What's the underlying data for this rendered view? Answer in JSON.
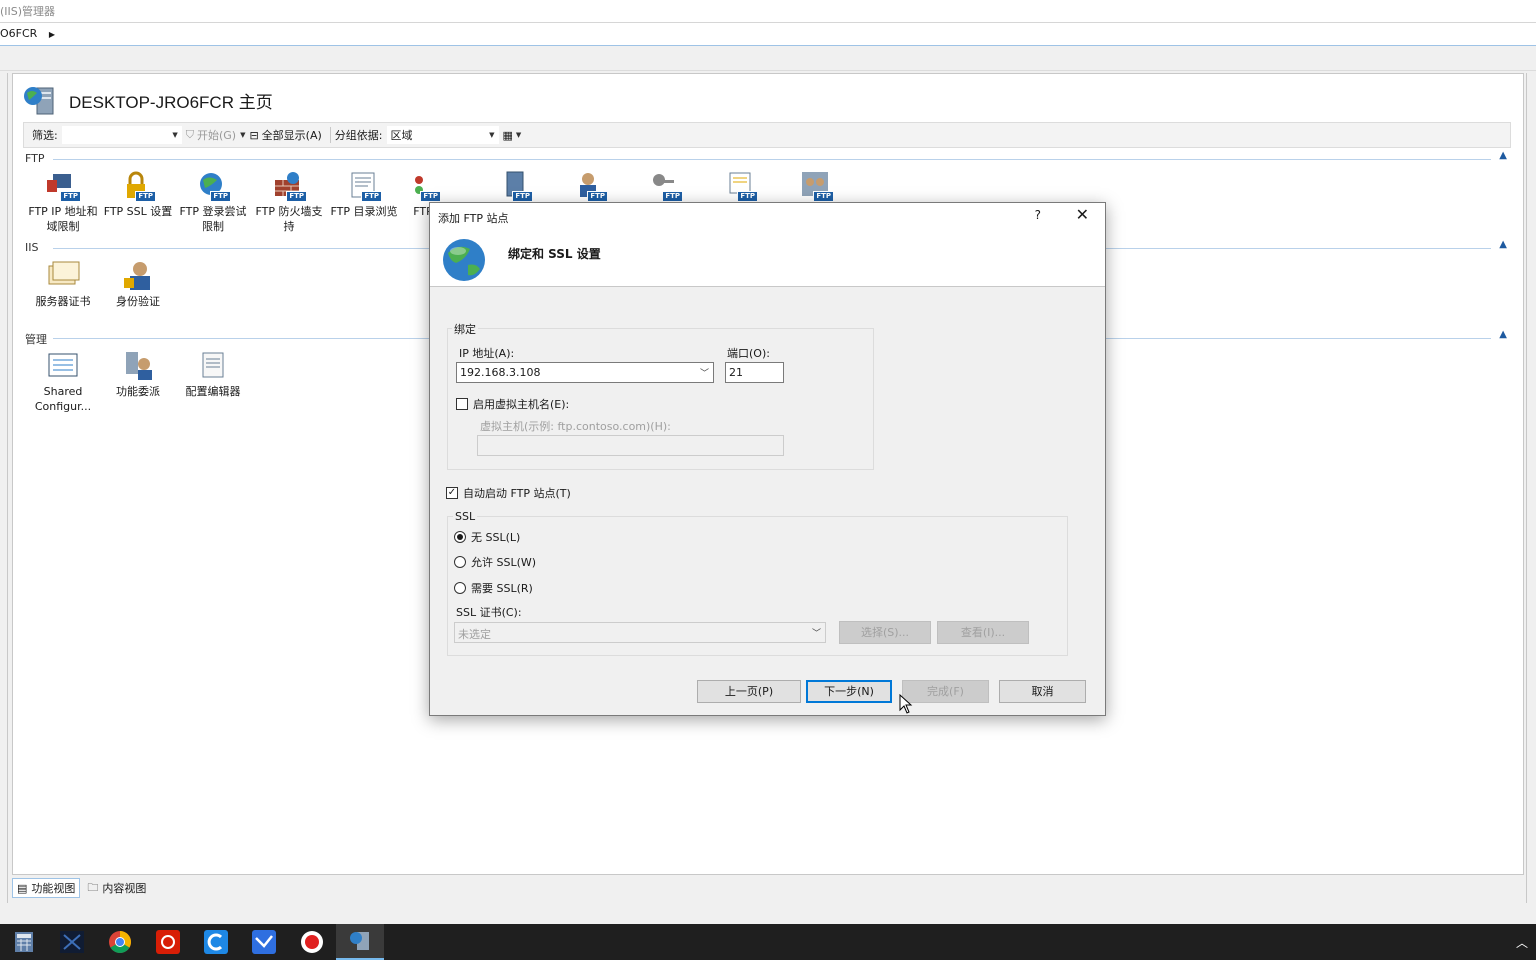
{
  "window": {
    "title_fragment": "(IIS)管理器",
    "address_fragment": "O6FCR"
  },
  "page": {
    "title": "DESKTOP-JRO6FCR 主页"
  },
  "toolbar": {
    "filter_label": "筛选:",
    "start_label": "开始(G)",
    "show_all_label": "全部显示(A)",
    "group_by_label": "分组依据:",
    "group_by_value": "区域"
  },
  "sections": {
    "ftp": "FTP",
    "iis": "IIS",
    "manage": "管理"
  },
  "features": {
    "ftp": [
      {
        "label": "FTP IP 地址和域限制",
        "icon": "ftp-ip-restrictions-icon"
      },
      {
        "label": "FTP SSL 设置",
        "icon": "ftp-ssl-settings-icon"
      },
      {
        "label": "FTP 登录尝试限制",
        "icon": "ftp-logon-attempt-icon"
      },
      {
        "label": "FTP 防火墙支持",
        "icon": "ftp-firewall-icon"
      },
      {
        "label": "FTP 目录浏览",
        "icon": "ftp-directory-browsing-icon"
      },
      {
        "label": "FTP",
        "icon": "ftp-logging-icon"
      }
    ],
    "iis": [
      {
        "label": "服务器证书",
        "icon": "server-certificates-icon"
      },
      {
        "label": "身份验证",
        "icon": "authentication-icon"
      }
    ],
    "manage": [
      {
        "label": "Shared Configur...",
        "icon": "shared-config-icon"
      },
      {
        "label": "功能委派",
        "icon": "feature-delegation-icon"
      },
      {
        "label": "配置编辑器",
        "icon": "config-editor-icon"
      }
    ]
  },
  "views": {
    "features_view": "功能视图",
    "content_view": "内容视图"
  },
  "dialog": {
    "title": "添加 FTP 站点",
    "help": "?",
    "close": "✕",
    "heading": "绑定和 SSL 设置",
    "binding": {
      "group_label": "绑定",
      "ip_label": "IP 地址(A):",
      "ip_value": "192.168.3.108",
      "port_label": "端口(O):",
      "port_value": "21",
      "virtual_host_checkbox": "启用虚拟主机名(E):",
      "virtual_host_label": "虚拟主机(示例: ftp.contoso.com)(H):",
      "virtual_host_value": ""
    },
    "auto_start": {
      "label": "自动启动 FTP 站点(T)",
      "checked": true
    },
    "ssl": {
      "group_label": "SSL",
      "options": [
        {
          "label": "无 SSL(L)",
          "selected": true
        },
        {
          "label": "允许 SSL(W)",
          "selected": false
        },
        {
          "label": "需要 SSL(R)",
          "selected": false
        }
      ],
      "cert_label": "SSL 证书(C):",
      "cert_value": "未选定",
      "select_button": "选择(S)...",
      "view_button": "查看(I)..."
    },
    "buttons": {
      "prev": "上一页(P)",
      "next": "下一步(N)",
      "finish": "完成(F)",
      "cancel": "取消"
    }
  },
  "taskbar": {
    "apps": [
      "calculator-icon",
      "app-icon",
      "chrome-icon",
      "netease-music-icon",
      "ccleaner-icon",
      "feishu-icon",
      "screen-recorder-icon",
      "iis-manager-icon"
    ]
  }
}
